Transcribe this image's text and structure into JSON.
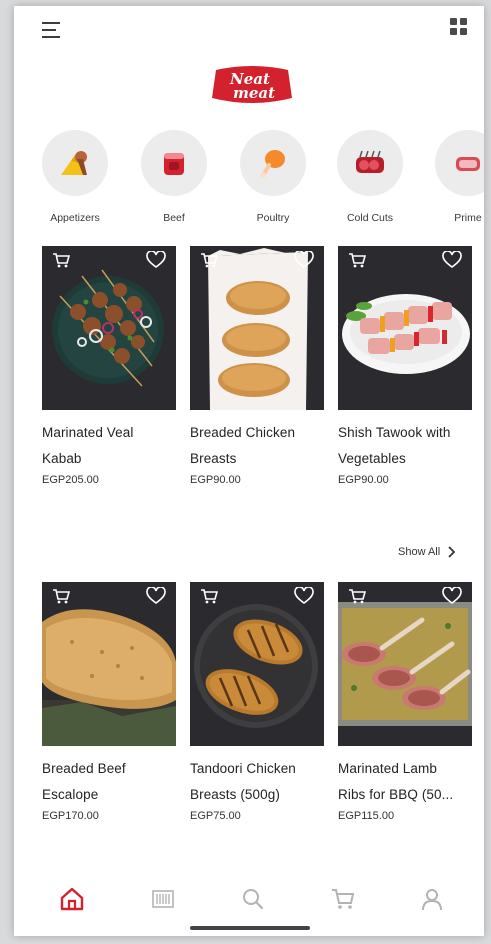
{
  "brand": {
    "line1": "Neat",
    "line2": "meat",
    "color": "#d3222e"
  },
  "categories": [
    {
      "label": "Appetizers",
      "icon": "appetizers-icon"
    },
    {
      "label": "Beef",
      "icon": "beef-icon"
    },
    {
      "label": "Poultry",
      "icon": "poultry-icon"
    },
    {
      "label": "Cold Cuts",
      "icon": "cold-cuts-icon"
    },
    {
      "label": "Prime",
      "icon": "prime-icon"
    }
  ],
  "section1": {
    "products": [
      {
        "name_l1": "Marinated Veal",
        "name_l2": "Kabab",
        "price": "EGP205.00"
      },
      {
        "name_l1": "Breaded Chicken",
        "name_l2": "Breasts",
        "price": "EGP90.00"
      },
      {
        "name_l1": "Shish Tawook with",
        "name_l2": "Vegetables",
        "price": "EGP90.00"
      }
    ]
  },
  "show_all": {
    "label": "Show All"
  },
  "section2": {
    "products": [
      {
        "name_l1": "Breaded Beef",
        "name_l2": "Escalope",
        "price": "EGP170.00"
      },
      {
        "name_l1": "Tandoori Chicken",
        "name_l2": "Breasts (500g)",
        "price": "EGP75.00"
      },
      {
        "name_l1": "Marinated Lamb",
        "name_l2": "Ribs for BBQ (50...",
        "price": "EGP115.00"
      }
    ]
  },
  "bottom_nav": {
    "items": [
      {
        "icon": "home-icon",
        "active": true
      },
      {
        "icon": "barcode-icon",
        "active": false
      },
      {
        "icon": "search-icon",
        "active": false
      },
      {
        "icon": "cart-icon",
        "active": false
      },
      {
        "icon": "profile-icon",
        "active": false
      }
    ],
    "active_color": "#d3222e",
    "inactive_color": "#b3b3b3"
  }
}
